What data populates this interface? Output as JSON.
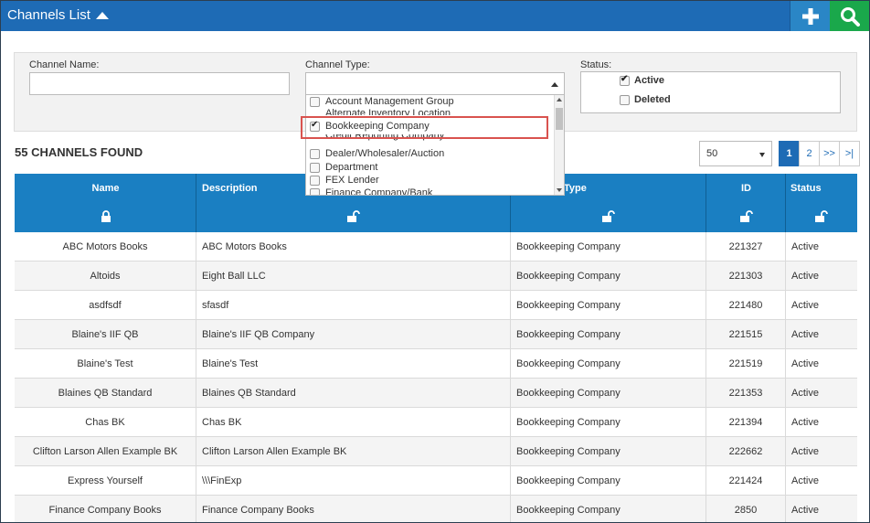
{
  "header": {
    "title": "Channels List",
    "add_icon": "plus-icon",
    "search_icon": "search-icon",
    "bg_color": "#1e6bb5"
  },
  "filters": {
    "channel_name_label": "Channel Name:",
    "channel_name_value": "",
    "channel_type_label": "Channel Type:",
    "channel_type_value": "",
    "status_label": "Status:",
    "status_options": [
      {
        "label": "Active",
        "checked": true
      },
      {
        "label": "Deleted",
        "checked": false
      }
    ]
  },
  "dropdown": {
    "items": [
      {
        "label": "Account Management Group",
        "checked": false
      },
      {
        "label": "Alternate Inventory Location",
        "checked": false
      },
      {
        "label": "Bookkeeping Company",
        "checked": true
      },
      {
        "label": "Credit Reporting Company",
        "checked": false
      },
      {
        "label": "Dealer/Wholesaler/Auction",
        "checked": false
      },
      {
        "label": "Department",
        "checked": false
      },
      {
        "label": "FEX Lender",
        "checked": false
      },
      {
        "label": "Finance Company/Bank",
        "checked": false
      }
    ]
  },
  "results": {
    "count_text": "55 CHANNELS FOUND",
    "per_page": "50",
    "pages": [
      "1",
      "2",
      ">>",
      ">|"
    ],
    "active_page": "1"
  },
  "table": {
    "columns": [
      "Name",
      "Description",
      "Type",
      "ID",
      "Status"
    ],
    "rows": [
      {
        "name": "ABC Motors Books",
        "description": "ABC Motors Books",
        "type": "Bookkeeping Company",
        "id": "221327",
        "status": "Active"
      },
      {
        "name": "Altoids",
        "description": "Eight Ball LLC",
        "type": "Bookkeeping Company",
        "id": "221303",
        "status": "Active"
      },
      {
        "name": "asdfsdf",
        "description": "sfasdf",
        "type": "Bookkeeping Company",
        "id": "221480",
        "status": "Active"
      },
      {
        "name": "Blaine's IIF QB",
        "description": "Blaine's IIF QB Company",
        "type": "Bookkeeping Company",
        "id": "221515",
        "status": "Active"
      },
      {
        "name": "Blaine's Test",
        "description": "Blaine's Test",
        "type": "Bookkeeping Company",
        "id": "221519",
        "status": "Active"
      },
      {
        "name": "Blaines QB Standard",
        "description": "Blaines QB Standard",
        "type": "Bookkeeping Company",
        "id": "221353",
        "status": "Active"
      },
      {
        "name": "Chas BK",
        "description": "Chas BK",
        "type": "Bookkeeping Company",
        "id": "221394",
        "status": "Active"
      },
      {
        "name": "Clifton Larson Allen Example BK",
        "description": "Clifton Larson Allen Example BK",
        "type": "Bookkeeping Company",
        "id": "222662",
        "status": "Active"
      },
      {
        "name": "Express Yourself",
        "description": "\\\\\\FinExp",
        "type": "Bookkeeping Company",
        "id": "221424",
        "status": "Active"
      },
      {
        "name": "Finance Company Books",
        "description": "Finance Company Books",
        "type": "Bookkeeping Company",
        "id": "2850",
        "status": "Active"
      }
    ]
  }
}
